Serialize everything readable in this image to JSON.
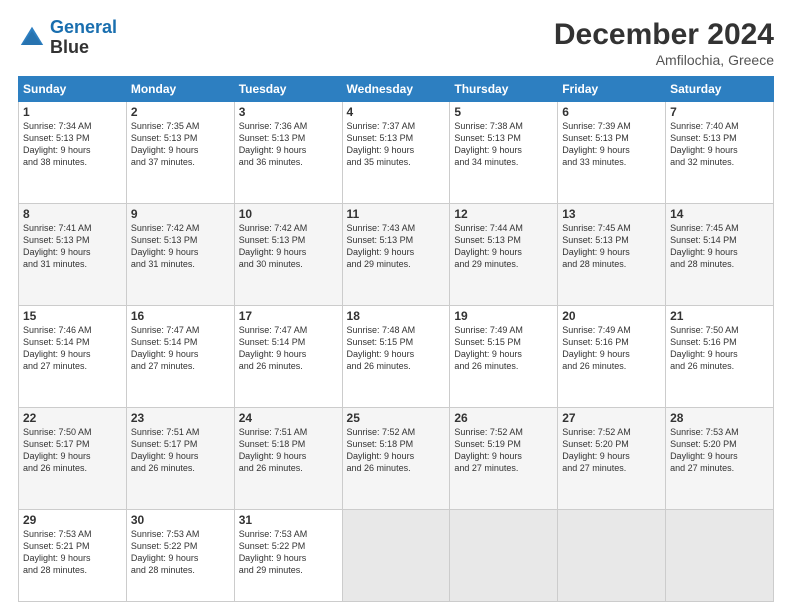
{
  "logo": {
    "line1": "General",
    "line2": "Blue"
  },
  "header": {
    "month_year": "December 2024",
    "location": "Amfilochia, Greece"
  },
  "weekdays": [
    "Sunday",
    "Monday",
    "Tuesday",
    "Wednesday",
    "Thursday",
    "Friday",
    "Saturday"
  ],
  "weeks": [
    [
      {
        "day": "1",
        "info": "Sunrise: 7:34 AM\nSunset: 5:13 PM\nDaylight: 9 hours\nand 38 minutes."
      },
      {
        "day": "2",
        "info": "Sunrise: 7:35 AM\nSunset: 5:13 PM\nDaylight: 9 hours\nand 37 minutes."
      },
      {
        "day": "3",
        "info": "Sunrise: 7:36 AM\nSunset: 5:13 PM\nDaylight: 9 hours\nand 36 minutes."
      },
      {
        "day": "4",
        "info": "Sunrise: 7:37 AM\nSunset: 5:13 PM\nDaylight: 9 hours\nand 35 minutes."
      },
      {
        "day": "5",
        "info": "Sunrise: 7:38 AM\nSunset: 5:13 PM\nDaylight: 9 hours\nand 34 minutes."
      },
      {
        "day": "6",
        "info": "Sunrise: 7:39 AM\nSunset: 5:13 PM\nDaylight: 9 hours\nand 33 minutes."
      },
      {
        "day": "7",
        "info": "Sunrise: 7:40 AM\nSunset: 5:13 PM\nDaylight: 9 hours\nand 32 minutes."
      }
    ],
    [
      {
        "day": "8",
        "info": "Sunrise: 7:41 AM\nSunset: 5:13 PM\nDaylight: 9 hours\nand 31 minutes."
      },
      {
        "day": "9",
        "info": "Sunrise: 7:42 AM\nSunset: 5:13 PM\nDaylight: 9 hours\nand 31 minutes."
      },
      {
        "day": "10",
        "info": "Sunrise: 7:42 AM\nSunset: 5:13 PM\nDaylight: 9 hours\nand 30 minutes."
      },
      {
        "day": "11",
        "info": "Sunrise: 7:43 AM\nSunset: 5:13 PM\nDaylight: 9 hours\nand 29 minutes."
      },
      {
        "day": "12",
        "info": "Sunrise: 7:44 AM\nSunset: 5:13 PM\nDaylight: 9 hours\nand 29 minutes."
      },
      {
        "day": "13",
        "info": "Sunrise: 7:45 AM\nSunset: 5:13 PM\nDaylight: 9 hours\nand 28 minutes."
      },
      {
        "day": "14",
        "info": "Sunrise: 7:45 AM\nSunset: 5:14 PM\nDaylight: 9 hours\nand 28 minutes."
      }
    ],
    [
      {
        "day": "15",
        "info": "Sunrise: 7:46 AM\nSunset: 5:14 PM\nDaylight: 9 hours\nand 27 minutes."
      },
      {
        "day": "16",
        "info": "Sunrise: 7:47 AM\nSunset: 5:14 PM\nDaylight: 9 hours\nand 27 minutes."
      },
      {
        "day": "17",
        "info": "Sunrise: 7:47 AM\nSunset: 5:14 PM\nDaylight: 9 hours\nand 26 minutes."
      },
      {
        "day": "18",
        "info": "Sunrise: 7:48 AM\nSunset: 5:15 PM\nDaylight: 9 hours\nand 26 minutes."
      },
      {
        "day": "19",
        "info": "Sunrise: 7:49 AM\nSunset: 5:15 PM\nDaylight: 9 hours\nand 26 minutes."
      },
      {
        "day": "20",
        "info": "Sunrise: 7:49 AM\nSunset: 5:16 PM\nDaylight: 9 hours\nand 26 minutes."
      },
      {
        "day": "21",
        "info": "Sunrise: 7:50 AM\nSunset: 5:16 PM\nDaylight: 9 hours\nand 26 minutes."
      }
    ],
    [
      {
        "day": "22",
        "info": "Sunrise: 7:50 AM\nSunset: 5:17 PM\nDaylight: 9 hours\nand 26 minutes."
      },
      {
        "day": "23",
        "info": "Sunrise: 7:51 AM\nSunset: 5:17 PM\nDaylight: 9 hours\nand 26 minutes."
      },
      {
        "day": "24",
        "info": "Sunrise: 7:51 AM\nSunset: 5:18 PM\nDaylight: 9 hours\nand 26 minutes."
      },
      {
        "day": "25",
        "info": "Sunrise: 7:52 AM\nSunset: 5:18 PM\nDaylight: 9 hours\nand 26 minutes."
      },
      {
        "day": "26",
        "info": "Sunrise: 7:52 AM\nSunset: 5:19 PM\nDaylight: 9 hours\nand 27 minutes."
      },
      {
        "day": "27",
        "info": "Sunrise: 7:52 AM\nSunset: 5:20 PM\nDaylight: 9 hours\nand 27 minutes."
      },
      {
        "day": "28",
        "info": "Sunrise: 7:53 AM\nSunset: 5:20 PM\nDaylight: 9 hours\nand 27 minutes."
      }
    ],
    [
      {
        "day": "29",
        "info": "Sunrise: 7:53 AM\nSunset: 5:21 PM\nDaylight: 9 hours\nand 28 minutes."
      },
      {
        "day": "30",
        "info": "Sunrise: 7:53 AM\nSunset: 5:22 PM\nDaylight: 9 hours\nand 28 minutes."
      },
      {
        "day": "31",
        "info": "Sunrise: 7:53 AM\nSunset: 5:22 PM\nDaylight: 9 hours\nand 29 minutes."
      },
      {
        "day": "",
        "info": ""
      },
      {
        "day": "",
        "info": ""
      },
      {
        "day": "",
        "info": ""
      },
      {
        "day": "",
        "info": ""
      }
    ]
  ]
}
